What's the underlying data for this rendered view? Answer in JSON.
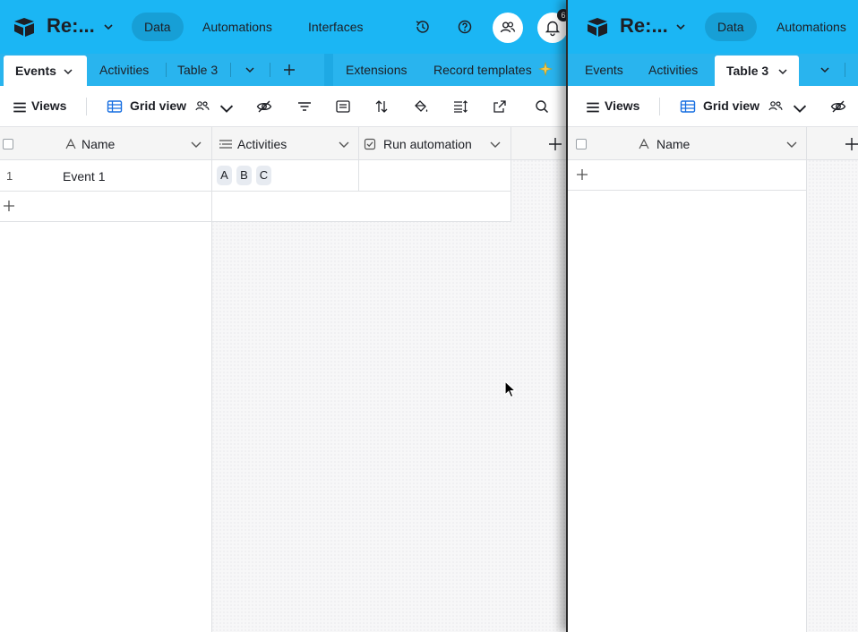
{
  "left": {
    "base_name": "Re:...",
    "nav": {
      "data": "Data",
      "automations": "Automations",
      "interfaces": "Interfaces"
    },
    "notification_badge": "6",
    "tabs": {
      "events": "Events",
      "activities": "Activities",
      "table3": "Table 3",
      "extensions": "Extensions",
      "record_templates": "Record templates"
    },
    "toolbar": {
      "views": "Views",
      "grid_view": "Grid view"
    },
    "columns": {
      "name": "Name",
      "activities": "Activities",
      "run_automation": "Run automation"
    },
    "rows": [
      {
        "index": "1",
        "name": "Event 1",
        "activities": [
          "A",
          "B",
          "C"
        ]
      }
    ]
  },
  "right": {
    "base_name": "Re:...",
    "nav": {
      "data": "Data",
      "automations": "Automations"
    },
    "tabs": {
      "events": "Events",
      "activities": "Activities",
      "table3": "Table 3"
    },
    "toolbar": {
      "views": "Views",
      "grid_view": "Grid view"
    },
    "columns": {
      "name": "Name"
    }
  },
  "colors": {
    "topbar": "#1bb6f4",
    "tabbar": "#1ea9e4",
    "accent_link": "#2d7ff9"
  }
}
